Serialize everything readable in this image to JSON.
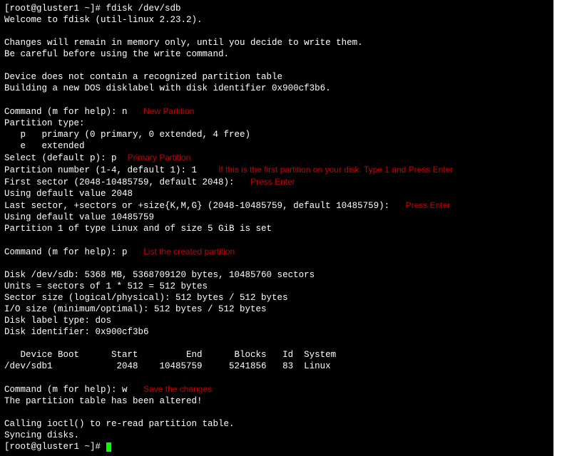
{
  "prompt1": "[root@gluster1 ~]# ",
  "cmd1": "fdisk /dev/sdb",
  "welcome": "Welcome to fdisk (util-linux 2.23.2).",
  "changes1": "Changes will remain in memory only, until you decide to write them.",
  "changes2": "Be careful before using the write command.",
  "dev1": "Device does not contain a recognized partition table",
  "dev2": "Building a new DOS disklabel with disk identifier 0x900cf3b6.",
  "cmd_n_prefix": "Command (m for help): ",
  "cmd_n_char": "n",
  "annot_new": "New Partition",
  "ptype": "Partition type:",
  "ptype_p": "   p   primary (0 primary, 0 extended, 4 free)",
  "ptype_e": "   e   extended",
  "select_p_prefix": "Select (default p): ",
  "select_p_char": "p",
  "annot_primary": "Primary Partition",
  "partnum_prefix": "Partition number (1-4, default 1): ",
  "partnum_char": "1",
  "annot_first": "If this is the first partition on your disk. Type 1 and Press Enter",
  "firstsect": "First sector (2048-10485759, default 2048): ",
  "annot_enter1": "Press Enter",
  "using1": "Using default value 2048",
  "lastsect": "Last sector, +sectors or +size{K,M,G} (2048-10485759, default 10485759): ",
  "annot_enter2": "Press Enter",
  "using2": "Using default value 10485759",
  "part1": "Partition 1 of type Linux and of size 5 GiB is set",
  "cmd_p_char": "p",
  "annot_list": "List the created partition",
  "disk1": "Disk /dev/sdb: 5368 MB, 5368709120 bytes, 10485760 sectors",
  "disk2": "Units = sectors of 1 * 512 = 512 bytes",
  "disk3": "Sector size (logical/physical): 512 bytes / 512 bytes",
  "disk4": "I/O size (minimum/optimal): 512 bytes / 512 bytes",
  "disk5": "Disk label type: dos",
  "disk6": "Disk identifier: 0x900cf3b6",
  "tblhdr": "   Device Boot      Start         End      Blocks   Id  System",
  "tblrow": "/dev/sdb1            2048    10485759     5241856   83  Linux",
  "cmd_w_char": "w",
  "annot_save": "Save the changes",
  "altered": "The partition table has been altered!",
  "calling": "Calling ioctl() to re-read partition table.",
  "syncing": "Syncing disks.",
  "prompt2": "[root@gluster1 ~]# "
}
